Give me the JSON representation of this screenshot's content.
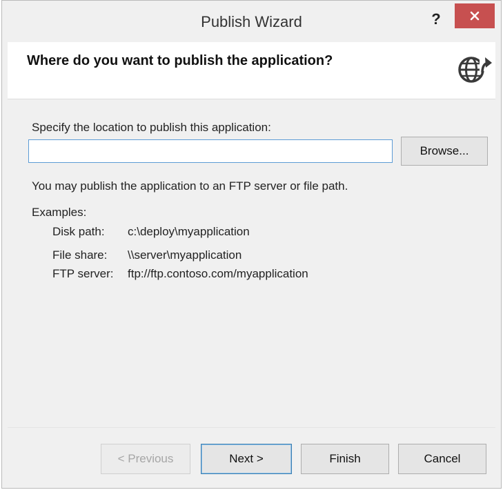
{
  "window": {
    "title": "Publish Wizard",
    "help_label": "?"
  },
  "header": {
    "title": "Where do you want to publish the application?"
  },
  "location": {
    "prompt": "Specify the location to publish this application:",
    "input_value": "",
    "browse_label": "Browse...",
    "hint": "You may publish the application to an FTP server or file path."
  },
  "examples": {
    "heading": "Examples:",
    "rows": [
      {
        "label": "Disk path:",
        "value": "c:\\deploy\\myapplication"
      },
      {
        "label": "File share:",
        "value": "\\\\server\\myapplication"
      },
      {
        "label": "FTP server:",
        "value": "ftp://ftp.contoso.com/myapplication"
      }
    ]
  },
  "footer": {
    "previous_label": "< Previous",
    "next_label": "Next >",
    "finish_label": "Finish",
    "cancel_label": "Cancel"
  },
  "icons": {
    "close": "close-icon",
    "help": "help-icon",
    "globe": "globe-publish-icon"
  },
  "colors": {
    "close_button": "#c75050",
    "input_border": "#5b9bd5",
    "default_button_border": "#3c7fb1"
  }
}
